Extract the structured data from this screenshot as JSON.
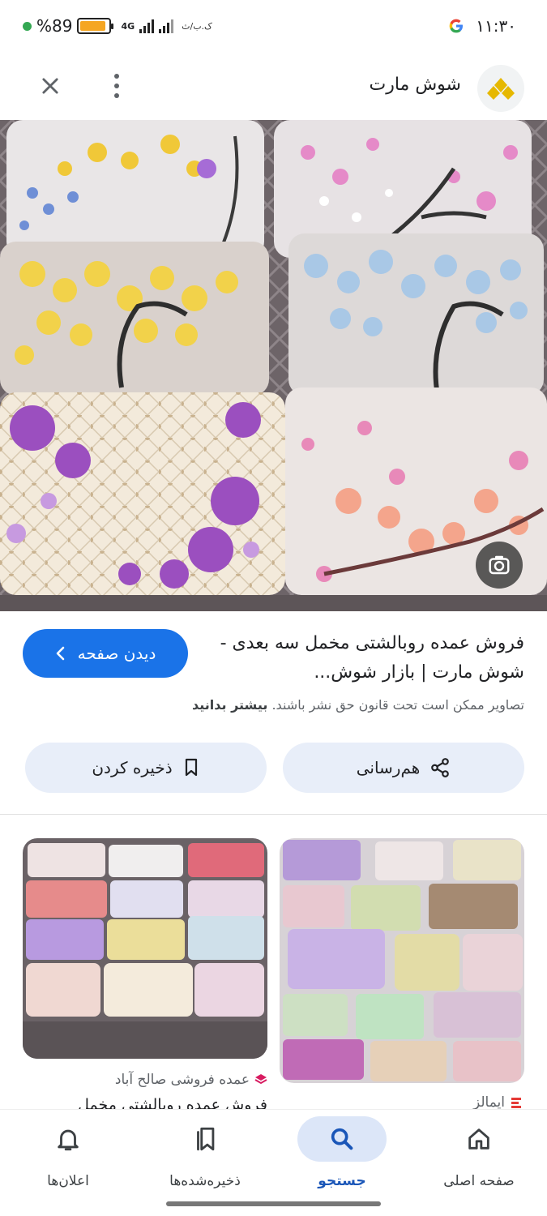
{
  "status_bar": {
    "battery_percent": "%89",
    "battery_level": 0.89,
    "network": "4G",
    "carrier": "ک.ب/ث",
    "time": "۱۱:۳۰",
    "g_icon": "google-g-icon"
  },
  "app_bar": {
    "site_name": "شوش مارت",
    "close_icon": "close-icon",
    "menu_icon": "more-vert-icon"
  },
  "result": {
    "title": "فروش عمده روبالشتی مخمل سه بعدی - شوش مارت | بازار شوش...",
    "visit_button": "دیدن صفحه",
    "copyright_text": "تصاویر ممکن است تحت قانون حق نشر باشند.",
    "learn_more": "بیشتر بدانید"
  },
  "actions": {
    "share": "هم‌رسانی",
    "save": "ذخیره کردن"
  },
  "related": [
    {
      "source": "ایمالز",
      "title": ""
    },
    {
      "source": "عمده فروشی صالح آباد",
      "title": "فروش عمده روبالشتی مخمل"
    }
  ],
  "bottom_nav": [
    {
      "label": "صفحه اصلی",
      "icon": "home-icon",
      "active": false
    },
    {
      "label": "جستجو",
      "icon": "search-icon",
      "active": true
    },
    {
      "label": "ذخیره‌شده‌ها",
      "icon": "bookmarks-icon",
      "active": false
    },
    {
      "label": "اعلان‌ها",
      "icon": "bell-icon",
      "active": false
    }
  ],
  "colors": {
    "accent": "#1a73e8",
    "chip_bg": "#e8eef9",
    "nav_active_bg": "#dce6f8"
  }
}
